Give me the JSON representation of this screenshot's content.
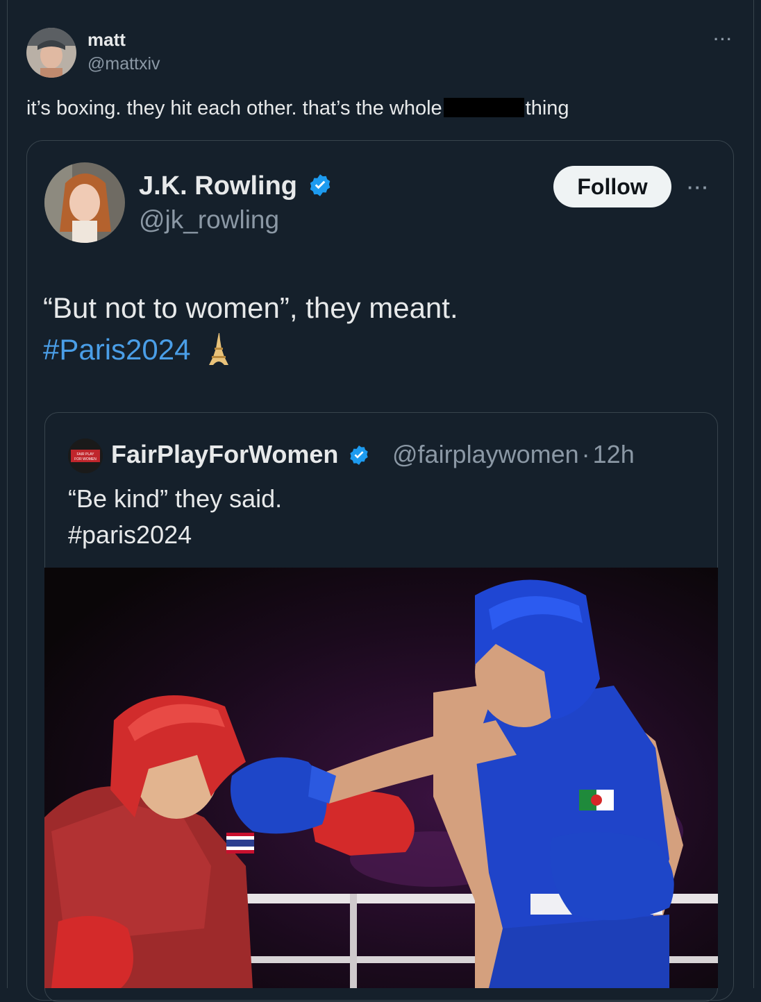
{
  "outer_tweet": {
    "name": "matt",
    "handle": "@mattxiv",
    "text_before": "it’s boxing. they hit each other. that’s the whole",
    "text_after": "thing",
    "more_label": "···"
  },
  "quoted_tweet": {
    "name": "J.K. Rowling",
    "handle": "@jk_rowling",
    "follow_label": "Follow",
    "more_label": "···",
    "text": "“But not to women”, they meant.",
    "hashtag": "#Paris2024",
    "verified_icon": "verified-badge-icon",
    "emoji_icon": "eiffel-tower-icon"
  },
  "nested_quote": {
    "name": "FairPlayForWomen",
    "handle": "@fairplaywomen",
    "separator": "·",
    "time": "12h",
    "text": "“Be kind” they said.",
    "hashtag": "#paris2024",
    "avatar_text": "FAIR PLAY FOR WOMEN"
  },
  "colors": {
    "background": "#15202b",
    "text": "#e7e9ea",
    "muted": "#8b98a5",
    "link": "#4a9ee7",
    "verified": "#1d9bf0",
    "border": "#38444d"
  }
}
